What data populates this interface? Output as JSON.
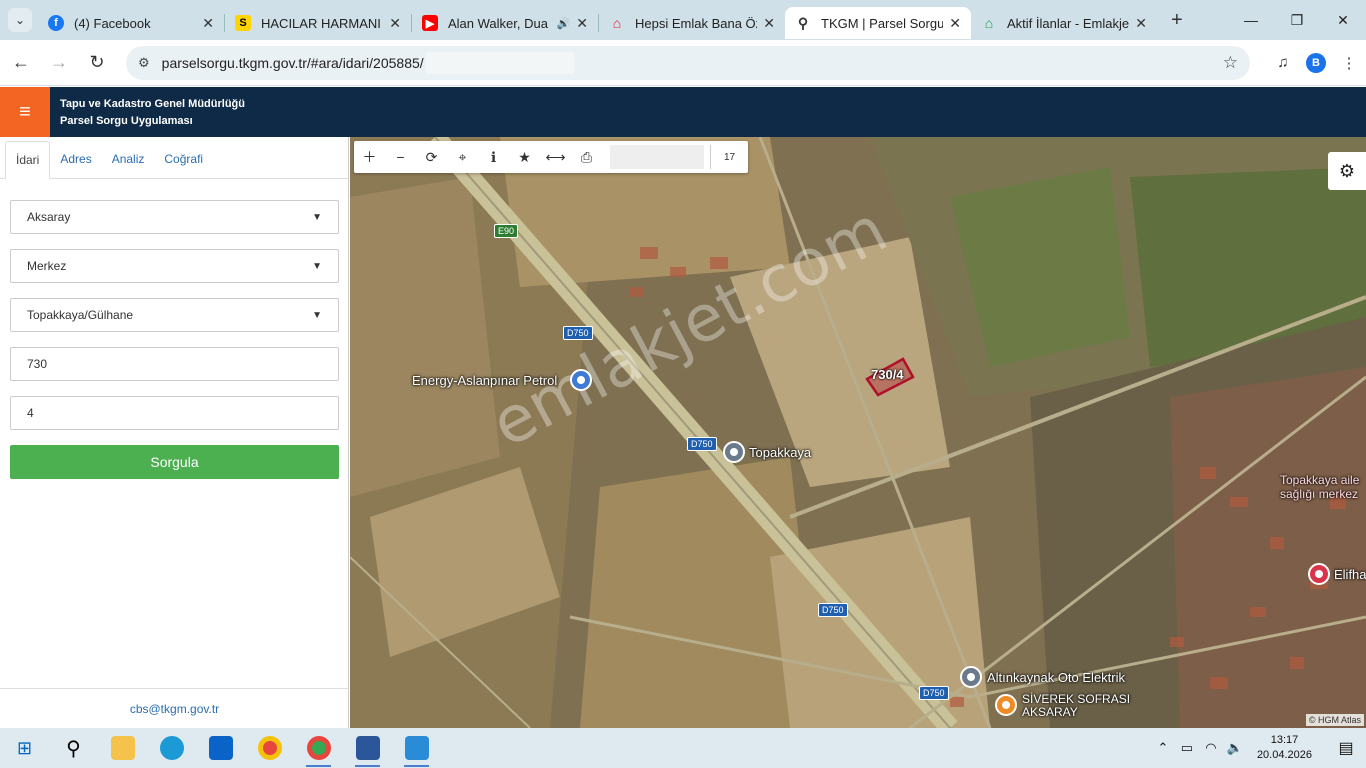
{
  "browser": {
    "tabs": [
      {
        "title": "(4) Facebook",
        "icon": "facebook-icon",
        "color": "#1877f2"
      },
      {
        "title": "HACILAR HARMANI",
        "icon": "sahibinden-icon",
        "color": "#ffd400"
      },
      {
        "title": "Alan Walker, Dua",
        "icon": "youtube-icon",
        "color": "#ff0000"
      },
      {
        "title": "Hepsi Emlak Bana Öz",
        "icon": "hepsiemlak-icon",
        "color": "#e4232b"
      },
      {
        "title": "TKGM | Parsel Sorgu",
        "icon": "location-pin-icon",
        "color": "#333333"
      },
      {
        "title": "Aktif İlanlar - Emlakje",
        "icon": "emlakjet-icon",
        "color": "#1aa34a"
      }
    ],
    "url": "parselsorgu.tkgm.gov.tr/#ara/idari/205885/"
  },
  "app": {
    "title_line1": "Tapu ve Kadastro Genel Müdürlüğü",
    "title_line2": "Parsel Sorgu Uygulaması",
    "brand_color": "#0e2a47",
    "accent_color": "#f26522"
  },
  "panel": {
    "tabs": [
      "İdari",
      "Adres",
      "Analiz",
      "Coğrafi"
    ],
    "province": "Aksaray",
    "district": "Merkez",
    "neighborhood": "Topakkaya/Gülhane",
    "block": "730",
    "parcel": "4",
    "submit_label": "Sorgula",
    "contact_email": "cbs@tkgm.gov.tr"
  },
  "map": {
    "zoom": "17",
    "parcel_label": "730/4",
    "places": {
      "petrol": "Energy-Aslanpınar Petrol",
      "village": "Topakkaya",
      "elektrik": "Altınkaynak Oto Elektrik",
      "sofrasi": "SİVEREK SOFRASI AKSARAY",
      "health1": "Topakkaya aile",
      "health2": "sağlığı merkez",
      "elif": "Elifha"
    },
    "roads": [
      "E90",
      "D750",
      "D750",
      "D750",
      "D750"
    ],
    "watermark": "emlakjet.com",
    "attribution": "© HGM Atlas"
  },
  "taskbar": {
    "time": "13:17",
    "date": "20.04.2026"
  }
}
